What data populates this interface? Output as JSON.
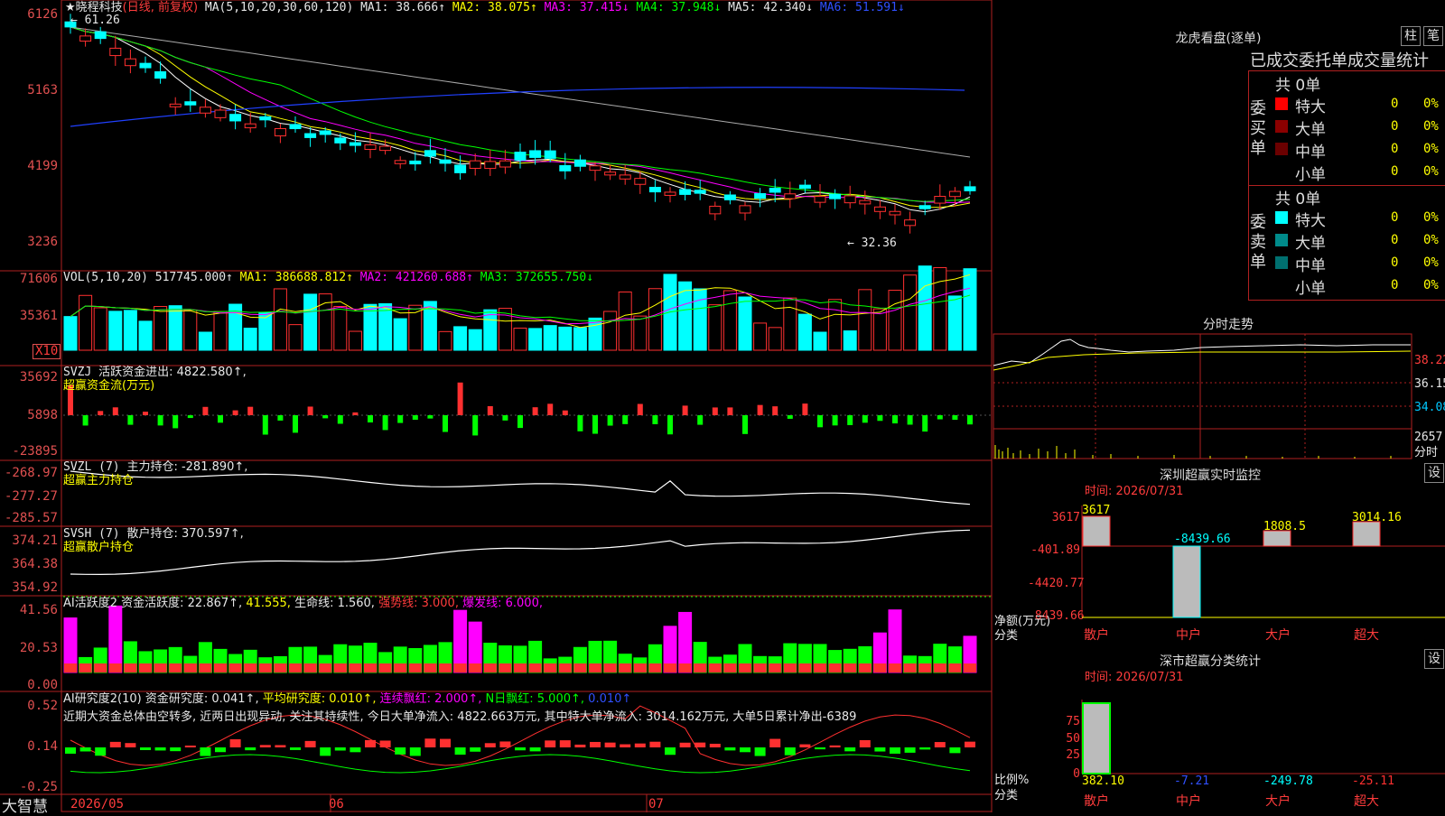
{
  "main_chart": {
    "title": "★晓程科技",
    "period": "(日线, 前复权)",
    "ma_label": "MA(5,10,20,30,60,120)",
    "ma_values": [
      "MA1: 38.666↑",
      "MA2: 38.075↑",
      "MA3: 37.415↓",
      "MA4: 37.948↓",
      "MA5: 42.340↓",
      "MA6: 51.591↓"
    ],
    "y_labels": [
      "6126",
      "5163",
      "4199",
      "3236"
    ],
    "high_mark": "61.26",
    "low_mark": "32.36"
  },
  "volume": {
    "label": "VOL(5,10,20)",
    "value": "517745.000↑",
    "ma1": "MA1: 386688.812↑",
    "ma2": "MA2: 421260.688↑",
    "ma3": "MA3: 372655.750↓",
    "y_labels": [
      "71606",
      "35361"
    ],
    "unit": "X10"
  },
  "svzj": {
    "label": "SVZJ",
    "text": "活跃资金进出: 4822.580↑,",
    "sub": "超赢资金流(万元)",
    "y_labels": [
      "35692",
      "5898",
      "-23895"
    ]
  },
  "svzl": {
    "label": "SVZL (7)",
    "text": "主力持仓: -281.890↑,",
    "sub": "超赢主力持仓",
    "y_labels": [
      "-268.97",
      "-277.27",
      "-285.57"
    ]
  },
  "svsh": {
    "label": "SVSH (7)",
    "text": "散户持仓: 370.597↑,",
    "sub": "超赢散户持仓",
    "y_labels": [
      "374.21",
      "364.38",
      "354.92"
    ]
  },
  "ai_active": {
    "label": "AI活跃度2",
    "t1": "资金活跃度: 22.867↑,",
    "t2": "41.555,",
    "t3": "生命线: 1.560,",
    "t4": "强势线: 3.000,",
    "t5": "爆发线: 6.000,",
    "y_labels": [
      "41.56",
      "20.53",
      "0.00"
    ]
  },
  "ai_research": {
    "label": "AI研究度2(10)",
    "t1": "资金研究度: 0.041↑,",
    "t2": "平均研究度: 0.010↑,",
    "t3": "连续飘红: 2.000↑,",
    "t4": "N日飘红: 5.000↑,",
    "t5": "0.010↑",
    "commentary": "近期大资金总体由空转多, 近两日出现异动, 关注其持续性, 今日大单净流入: 4822.663万元, 其中特大单净流入: 3014.162万元, 大单5日累计净出-6389",
    "y_labels": [
      "0.52",
      "0.14",
      "-0.25"
    ]
  },
  "bottom_axis": {
    "logo": "大智慧",
    "dates": [
      "2026/05",
      "06",
      "07"
    ]
  },
  "dragon_tiger": {
    "title": "龙虎看盘(逐单)",
    "btn_bar": "柱",
    "btn_detail": "笔",
    "subtitle": "已成交委托单成交量统计",
    "buy_side_label": "委买单",
    "sell_side_label": "委卖单",
    "buy_total": "共 0单",
    "sell_total": "共 0单",
    "buy_rows": [
      {
        "name": "特大",
        "count": "0",
        "pct": "0%",
        "color": "#ff0000"
      },
      {
        "name": "大单",
        "count": "0",
        "pct": "0%",
        "color": "#8b0000"
      },
      {
        "name": "中单",
        "count": "0",
        "pct": "0%",
        "color": "#6b0000"
      },
      {
        "name": "小单",
        "count": "0",
        "pct": "0%",
        "color": "#000000"
      }
    ],
    "sell_rows": [
      {
        "name": "特大",
        "count": "0",
        "pct": "0%",
        "color": "#00ffff"
      },
      {
        "name": "大单",
        "count": "0",
        "pct": "0%",
        "color": "#008b8b"
      },
      {
        "name": "中单",
        "count": "0",
        "pct": "0%",
        "color": "#007070"
      },
      {
        "name": "小单",
        "count": "0",
        "pct": "0%",
        "color": "#000000"
      }
    ]
  },
  "intraday": {
    "title": "分时走势",
    "y_labels": [
      "38.22",
      "36.15",
      "34.08",
      "2657"
    ],
    "footer": "分时"
  },
  "sz_monitor": {
    "title": "深圳超赢实时监控",
    "btn": "设",
    "time": "时间: 2026/07/31",
    "y_labels": [
      "3617",
      "-401.89",
      "-4420.77",
      "-8439.66"
    ],
    "y_caption": "净额(万元)",
    "x_caption": "分类",
    "bar_values": [
      "3617",
      "-8439.66",
      "1808.5",
      "3014.16"
    ],
    "categories": [
      "散户",
      "中户",
      "大户",
      "超大"
    ]
  },
  "sz_classify": {
    "title": "深市超赢分类统计",
    "btn": "设",
    "time": "时间: 2026/07/31",
    "y_labels": [
      "75",
      "50",
      "25",
      "0"
    ],
    "y_caption": "比例%",
    "x_caption": "分类",
    "values": [
      "382.10",
      "-7.21",
      "-249.78",
      "-25.11"
    ],
    "categories": [
      "散户",
      "中户",
      "大户",
      "超大"
    ]
  },
  "colors": {
    "up": "#ff3030",
    "down": "#00ffff",
    "border": "#b02020"
  }
}
